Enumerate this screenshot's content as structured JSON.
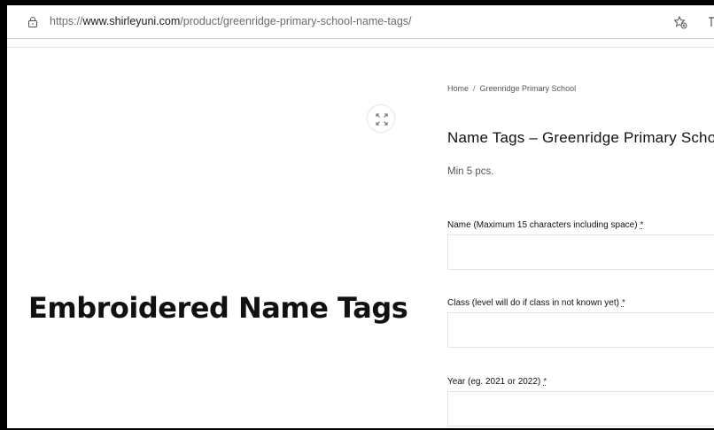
{
  "browser": {
    "url_prefix": "https://",
    "url_domain": "www.shirleyuni.com",
    "url_path": "/product/greenridge-primary-school-name-tags/"
  },
  "product": {
    "image_caption": "Embroidered Name Tags",
    "breadcrumb": {
      "home": "Home",
      "separator": "/",
      "current": "Greenridge Primary School"
    },
    "title": "Name Tags – Greenridge Primary School",
    "min_qty": "Min 5 pcs."
  },
  "form": {
    "required_marker": "*",
    "fields": [
      {
        "label": "Name (Maximum 15 characters including space)",
        "value": ""
      },
      {
        "label": "Class (level will do if class in not known yet)",
        "value": ""
      },
      {
        "label": "Year (eg. 2021 or 2022)",
        "value": ""
      }
    ]
  },
  "icons": {
    "lock": "lock-icon",
    "favorite": "add-favorite-icon",
    "zoom": "expand-icon"
  }
}
